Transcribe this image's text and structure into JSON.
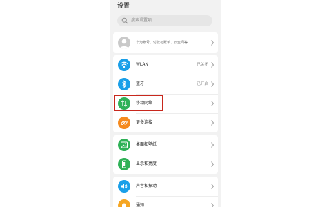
{
  "page_title": "设置",
  "search": {
    "placeholder": "搜索设置项"
  },
  "account": {
    "subtitle": "华为帐号、付款与账单、云空间等"
  },
  "items": [
    {
      "label": "WLAN",
      "status": "已关闭",
      "icon": "wifi-icon",
      "color": "#1a9fe8"
    },
    {
      "label": "蓝牙",
      "status": "已开启",
      "icon": "bluetooth-icon",
      "color": "#1a9fe8"
    },
    {
      "label": "移动网络",
      "status": "",
      "icon": "mobile-data-icon",
      "color": "#2fb157"
    },
    {
      "label": "更多连接",
      "status": "",
      "icon": "link-icon",
      "color": "#f58a1f"
    },
    {
      "label": "桌面和壁纸",
      "status": "",
      "icon": "wallpaper-icon",
      "color": "#2fb157"
    },
    {
      "label": "显示和亮度",
      "status": "",
      "icon": "display-icon",
      "color": "#2fb157"
    },
    {
      "label": "声音和振动",
      "status": "",
      "icon": "sound-icon",
      "color": "#1a9fe8"
    },
    {
      "label": "通知",
      "status": "",
      "icon": "notification-icon",
      "color": "#f5a623"
    }
  ],
  "highlight_color": "#c8281d"
}
